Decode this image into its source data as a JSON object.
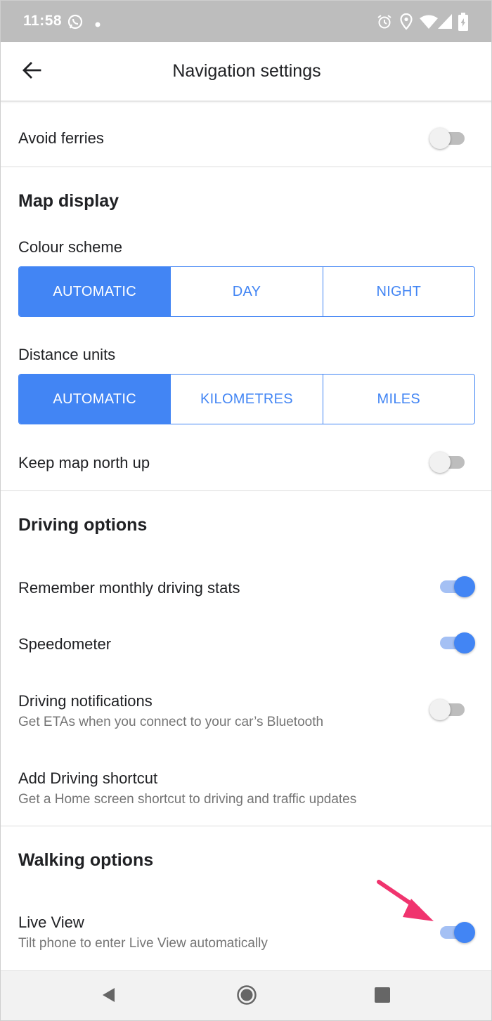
{
  "status_bar": {
    "time": "11:58",
    "icons": [
      "whatsapp-icon",
      "dot-icon",
      "alarm-icon",
      "location-icon",
      "wifi-icon",
      "signal-icon",
      "battery-icon"
    ]
  },
  "app_bar": {
    "title": "Navigation settings",
    "back_icon": "arrow-back-icon"
  },
  "settings": {
    "avoid_ferries": {
      "label": "Avoid ferries",
      "enabled": false
    },
    "map_display": {
      "title": "Map display",
      "colour_scheme": {
        "label": "Colour scheme",
        "options": [
          "AUTOMATIC",
          "DAY",
          "NIGHT"
        ],
        "selected": "AUTOMATIC"
      },
      "distance_units": {
        "label": "Distance units",
        "options": [
          "AUTOMATIC",
          "KILOMETRES",
          "MILES"
        ],
        "selected": "AUTOMATIC"
      },
      "keep_north_up": {
        "label": "Keep map north up",
        "enabled": false
      }
    },
    "driving_options": {
      "title": "Driving options",
      "monthly_stats": {
        "label": "Remember monthly driving stats",
        "enabled": true
      },
      "speedometer": {
        "label": "Speedometer",
        "enabled": true
      },
      "notifications": {
        "label": "Driving notifications",
        "sub": "Get ETAs when you connect to your car’s Bluetooth",
        "enabled": false
      },
      "shortcut": {
        "label": "Add Driving shortcut",
        "sub": "Get a Home screen shortcut to driving and traffic updates"
      }
    },
    "walking_options": {
      "title": "Walking options",
      "live_view": {
        "label": "Live View",
        "sub": "Tilt phone to enter Live View automatically",
        "enabled": true
      }
    }
  },
  "nav_bar": {
    "icons": [
      "back-triangle-icon",
      "home-circle-icon",
      "recents-square-icon"
    ]
  },
  "colors": {
    "accent": "#4285f4",
    "accent_track": "#a4c0f4",
    "status_bar": "#bdbdbd",
    "arrow": "#f0346e"
  }
}
